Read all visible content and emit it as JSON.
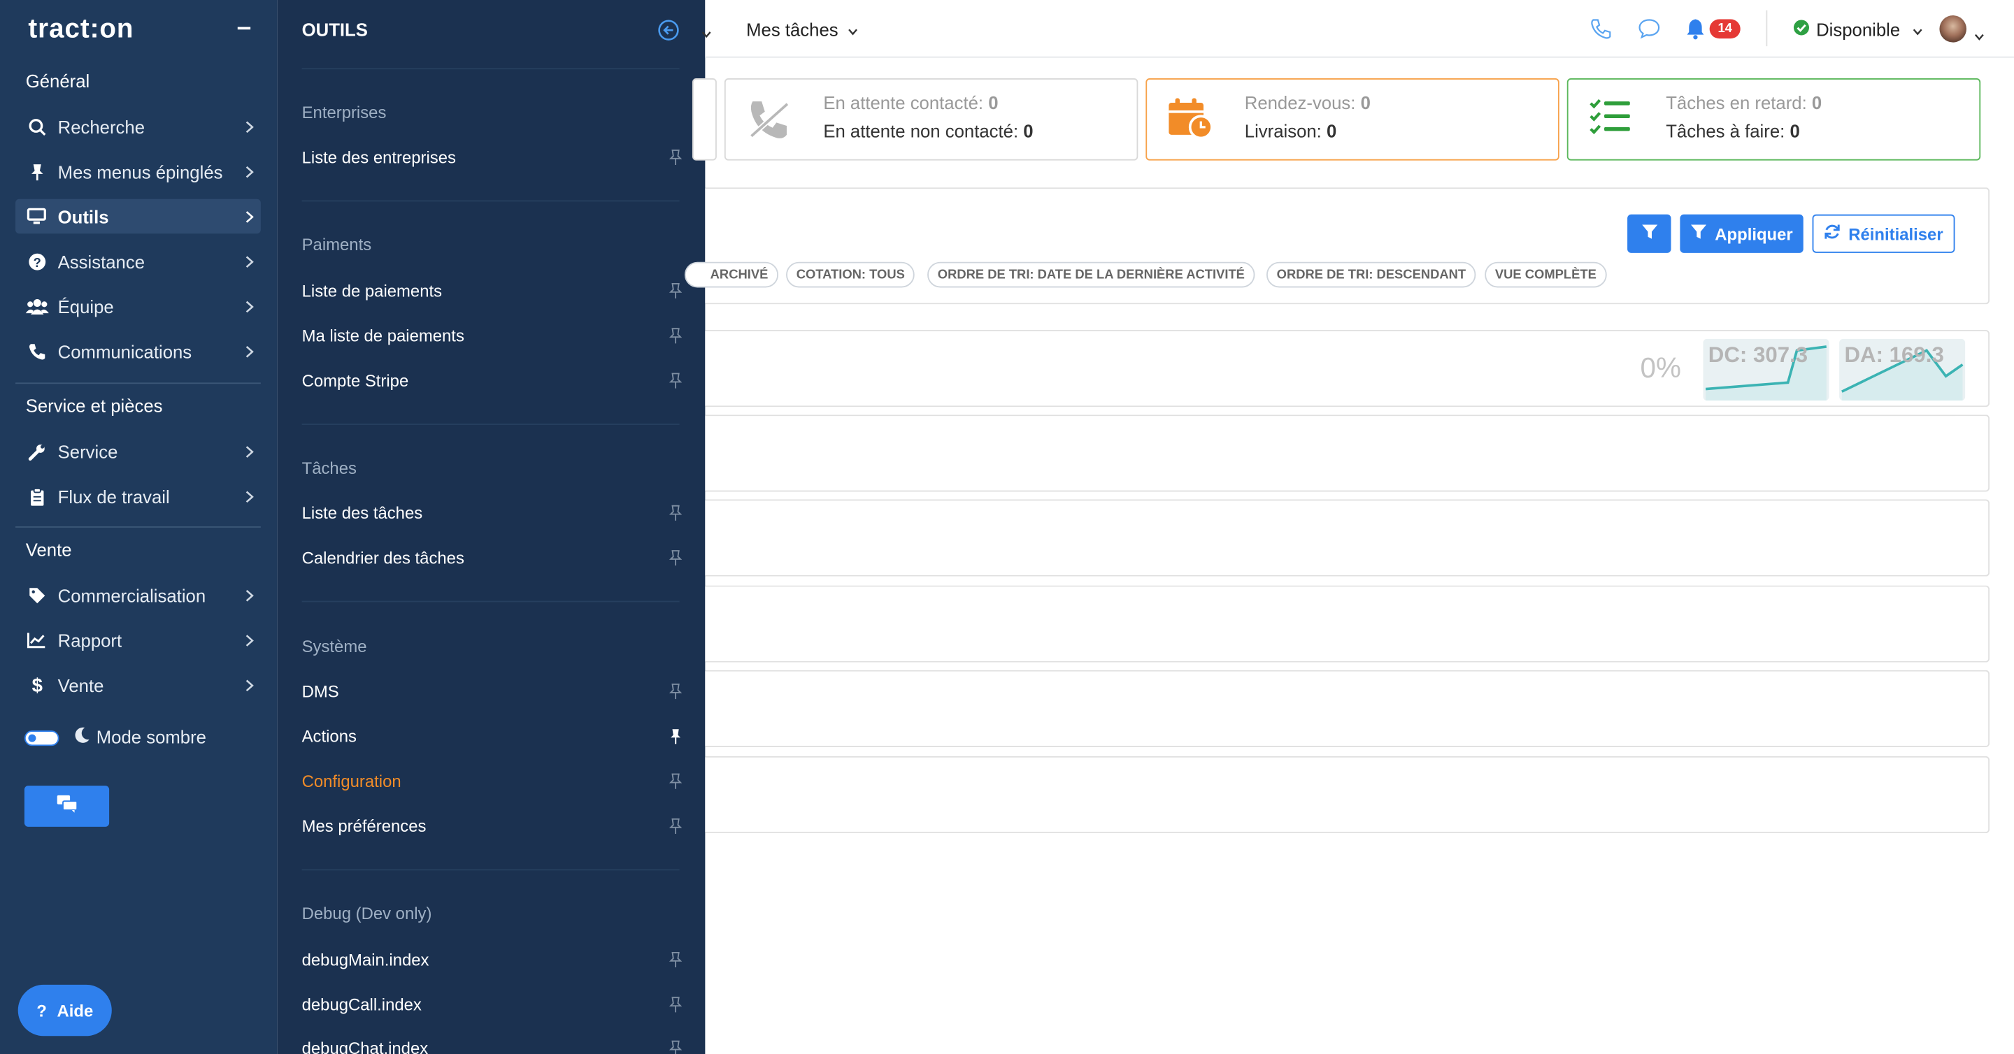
{
  "sidebar": {
    "logo_prefix": "tract",
    "logo_suffix": "on",
    "section_general": "Général",
    "items_general": [
      "Recherche",
      "Mes menus épinglés",
      "Outils",
      "Assistance",
      "Équipe",
      "Communications"
    ],
    "section_service": "Service et pièces",
    "items_service": [
      "Service",
      "Flux de travail"
    ],
    "section_vente": "Vente",
    "items_vente": [
      "Commercialisation",
      "Rapport",
      "Vente"
    ],
    "dark_mode_label": "Mode sombre",
    "help_label": "Aide"
  },
  "panel": {
    "title": "OUTILS",
    "sections": [
      {
        "title": "Enterprises",
        "items": [
          "Liste des entreprises"
        ]
      },
      {
        "title": "Paiments",
        "items": [
          "Liste de paiements",
          "Ma liste de paiements",
          "Compte Stripe"
        ]
      },
      {
        "title": "Tâches",
        "items": [
          "Liste des tâches",
          "Calendrier des tâches"
        ]
      },
      {
        "title": "Système",
        "items": [
          "DMS",
          "Actions",
          "Configuration",
          "Mes préférences"
        ]
      },
      {
        "title": "Debug (Dev only)",
        "items": [
          "debugMain.index",
          "debugCall.index",
          "debugChat.index"
        ]
      }
    ],
    "highlighted_item": "Configuration",
    "pinned_item": "Actions"
  },
  "topbar": {
    "tasks_menu": "Mes tâches",
    "notification_count": "14",
    "status": "Disponible"
  },
  "cards": {
    "calls": {
      "line1_label": "En attente contacté:",
      "line1_value": "0",
      "line2_label": "En attente non contacté:",
      "line2_value": "0"
    },
    "appointments": {
      "line1_label": "Rendez-vous:",
      "line1_value": "0",
      "line2_label": "Livraison:",
      "line2_value": "0"
    },
    "tasks": {
      "line1_label": "Tâches en retard:",
      "line1_value": "0",
      "line2_label": "Tâches à faire:",
      "line2_value": "0"
    }
  },
  "filters": {
    "apply_label": "Appliquer",
    "reset_label": "Réinitialiser",
    "chips": [
      "ARCHIVÉ",
      "COTATION: TOUS",
      "ORDRE DE TRI: DATE DE LA DERNIÈRE ACTIVITÉ",
      "ORDRE DE TRI: DESCENDANT",
      "VUE COMPLÈTE"
    ]
  },
  "stats": {
    "percent": "0%",
    "dc_label": "DC: 307.3",
    "da_label": "DA: 169.3"
  },
  "colors": {
    "sidebar_bg": "#1f3a5c",
    "panel_bg": "#1b3150",
    "accent_blue": "#2f80ed",
    "accent_orange": "#f28c28",
    "accent_green": "#2e9e3a",
    "badge_red": "#e53935",
    "spark_teal": "#3bb3b3"
  }
}
